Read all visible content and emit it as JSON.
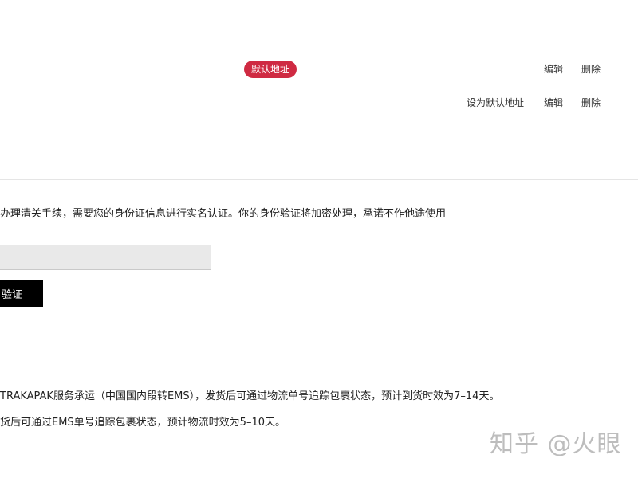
{
  "addresses": [
    {
      "badge": "默认地址",
      "edit_label": "编辑",
      "delete_label": "删除"
    },
    {
      "set_default_label": "设为默认地址",
      "edit_label": "编辑",
      "delete_label": "删除"
    }
  ],
  "verification": {
    "notice": "办理清关手续，需要您的身份证信息进行实名认证。你的身份验证将加密处理，承诺不作他途使用",
    "input_value": "",
    "input_placeholder": "",
    "button_label": "验证"
  },
  "shipping": {
    "line1": "TRAKAPAK服务承运（中国国内段转EMS），发货后可通过物流单号追踪包裹状态，预计到货时效为7–14天。",
    "line2": "货后可通过EMS单号追踪包裹状态，预计物流时效为5–10天。"
  },
  "watermark": "知乎 @火眼",
  "colors": {
    "badge_bg": "#cf2a42",
    "button_bg": "#000000",
    "input_bg": "#e9e9e9"
  }
}
